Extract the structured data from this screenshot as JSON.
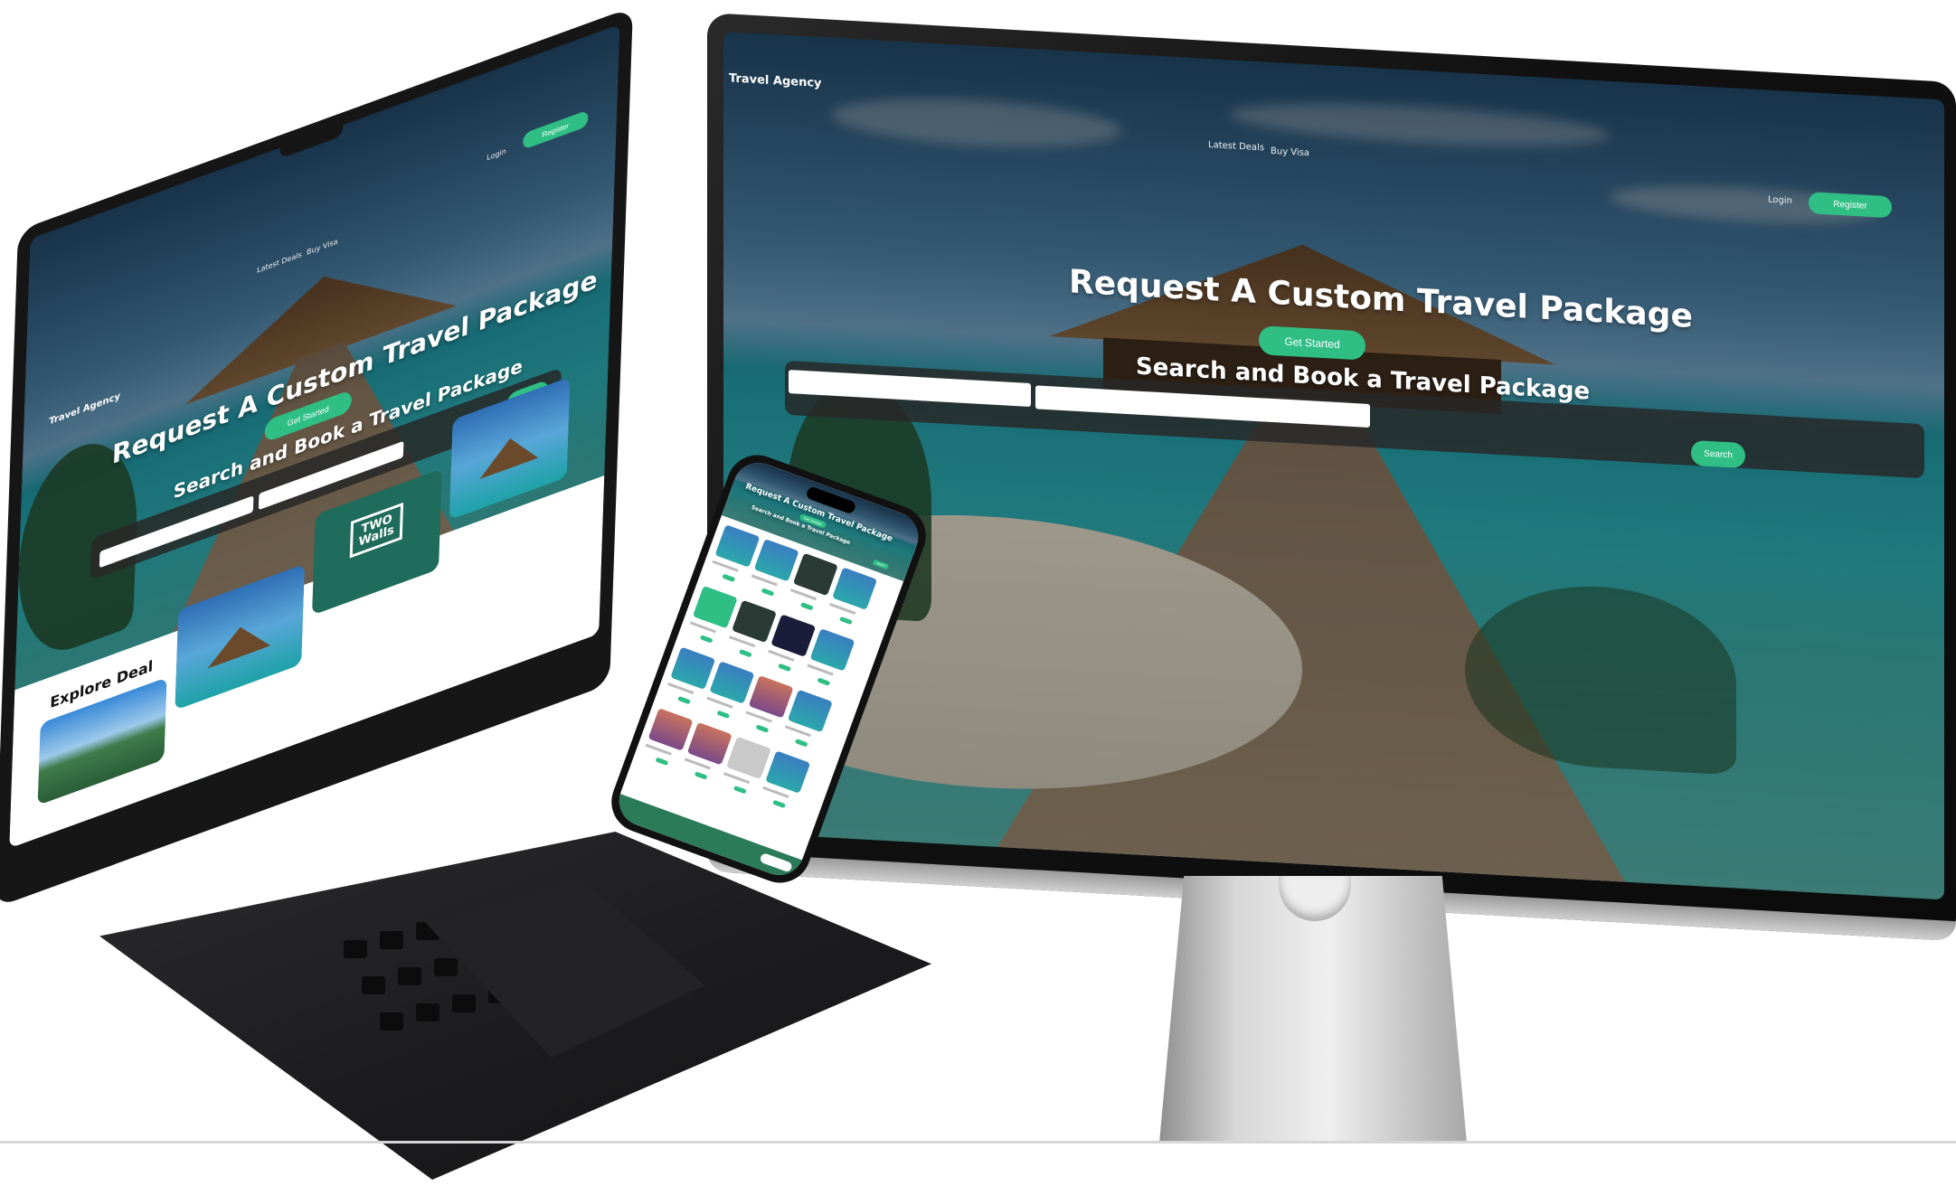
{
  "site": {
    "brand": "Travel Agency",
    "nav": [
      "Latest Deals",
      "Buy Visa"
    ],
    "login_label": "Login",
    "register_label": "Register",
    "hero_title": "Request A Custom Travel Package",
    "cta_label": "Get Started",
    "search_title": "Search and Book a Travel Package",
    "search_button": "Search",
    "explore_heading": "Explore Deal",
    "brand_card_text": "TWO Walls"
  },
  "colors": {
    "accent": "#2fbf84",
    "search_bar": "#282828",
    "footer": "#2b7a58"
  }
}
